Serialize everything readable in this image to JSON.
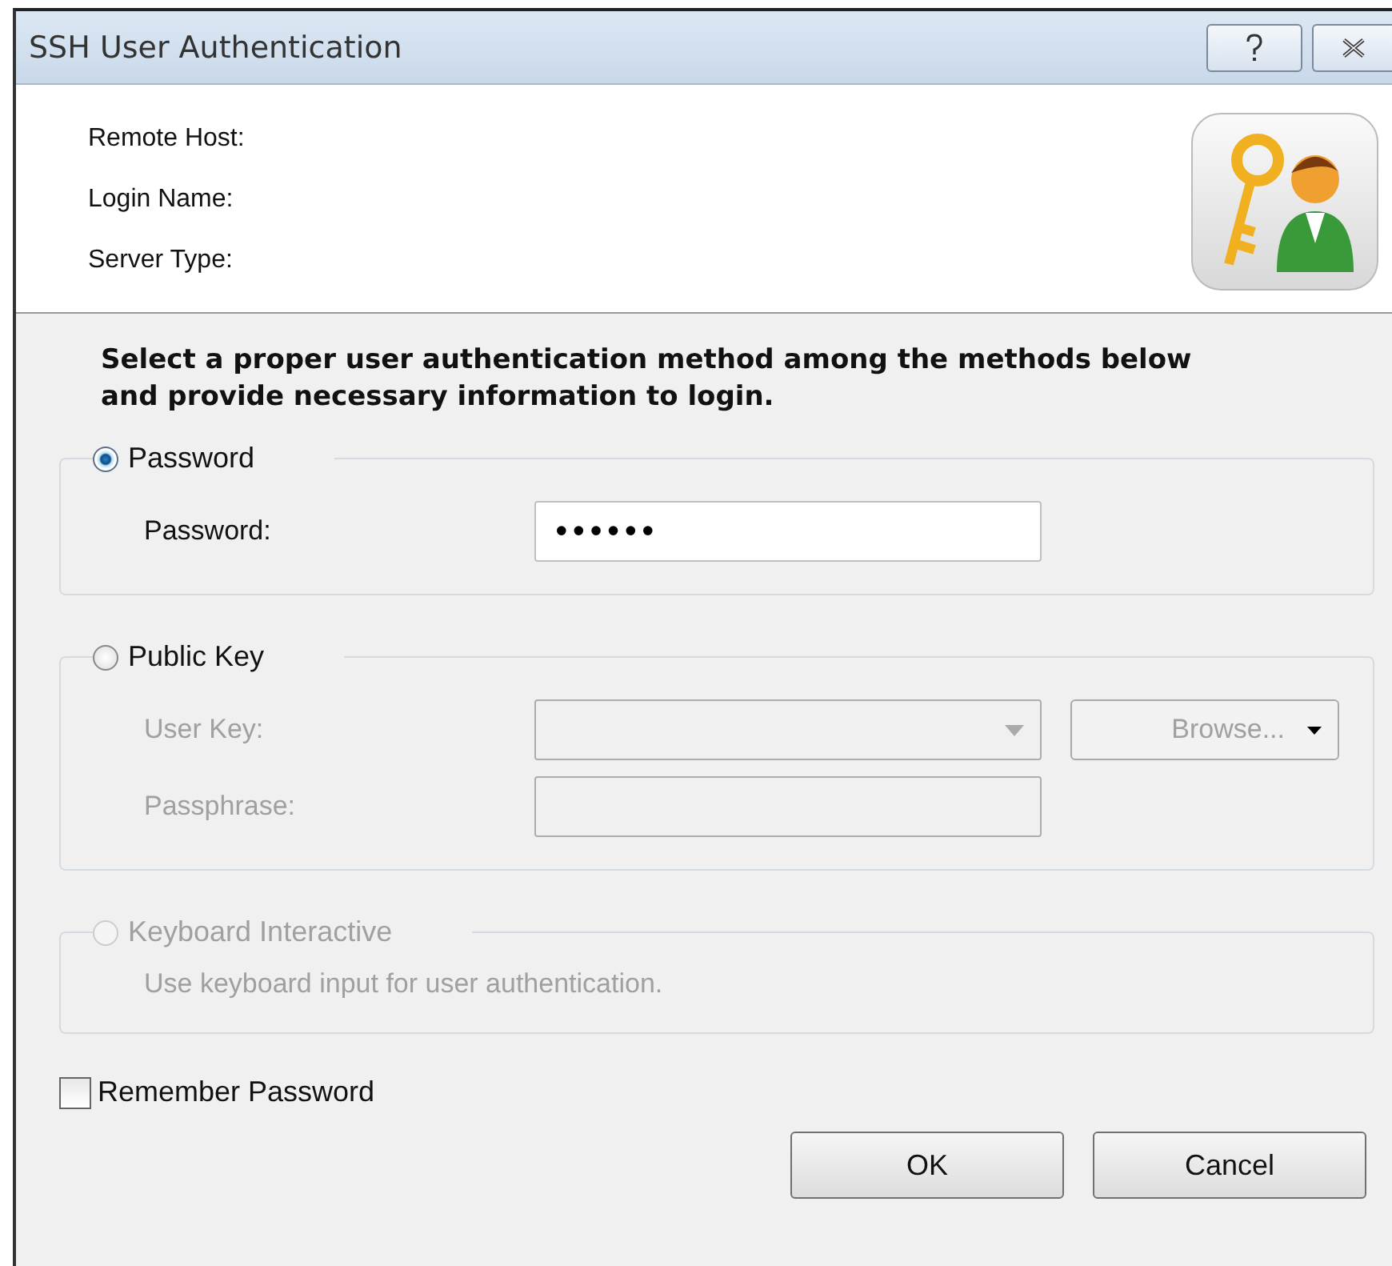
{
  "window": {
    "title": "SSH User Authentication"
  },
  "info": {
    "labels": [
      "Remote Host:",
      "Login Name:",
      "Server Type:"
    ]
  },
  "instruction": "Select a proper user authentication method among the methods below and provide necessary information to login.",
  "methods": [
    {
      "kind": "password",
      "label": "Password",
      "selected": true,
      "disabled": false,
      "fields": [
        {
          "kind": "text",
          "label": "Password:",
          "value": "••••••"
        }
      ]
    },
    {
      "kind": "publickey",
      "label": "Public Key",
      "selected": false,
      "disabled": false,
      "fields": [
        {
          "kind": "dropdown",
          "label": "User Key:"
        },
        {
          "kind": "text",
          "label": "Passphrase:"
        }
      ],
      "browse_button": "Browse..."
    },
    {
      "kind": "keyboard",
      "label": "Keyboard Interactive",
      "selected": false,
      "disabled": true,
      "description": "Use keyboard input for user authentication."
    }
  ],
  "remember_password": {
    "label": "Remember Password",
    "checked": false
  },
  "buttons": [
    "OK",
    "Cancel"
  ]
}
